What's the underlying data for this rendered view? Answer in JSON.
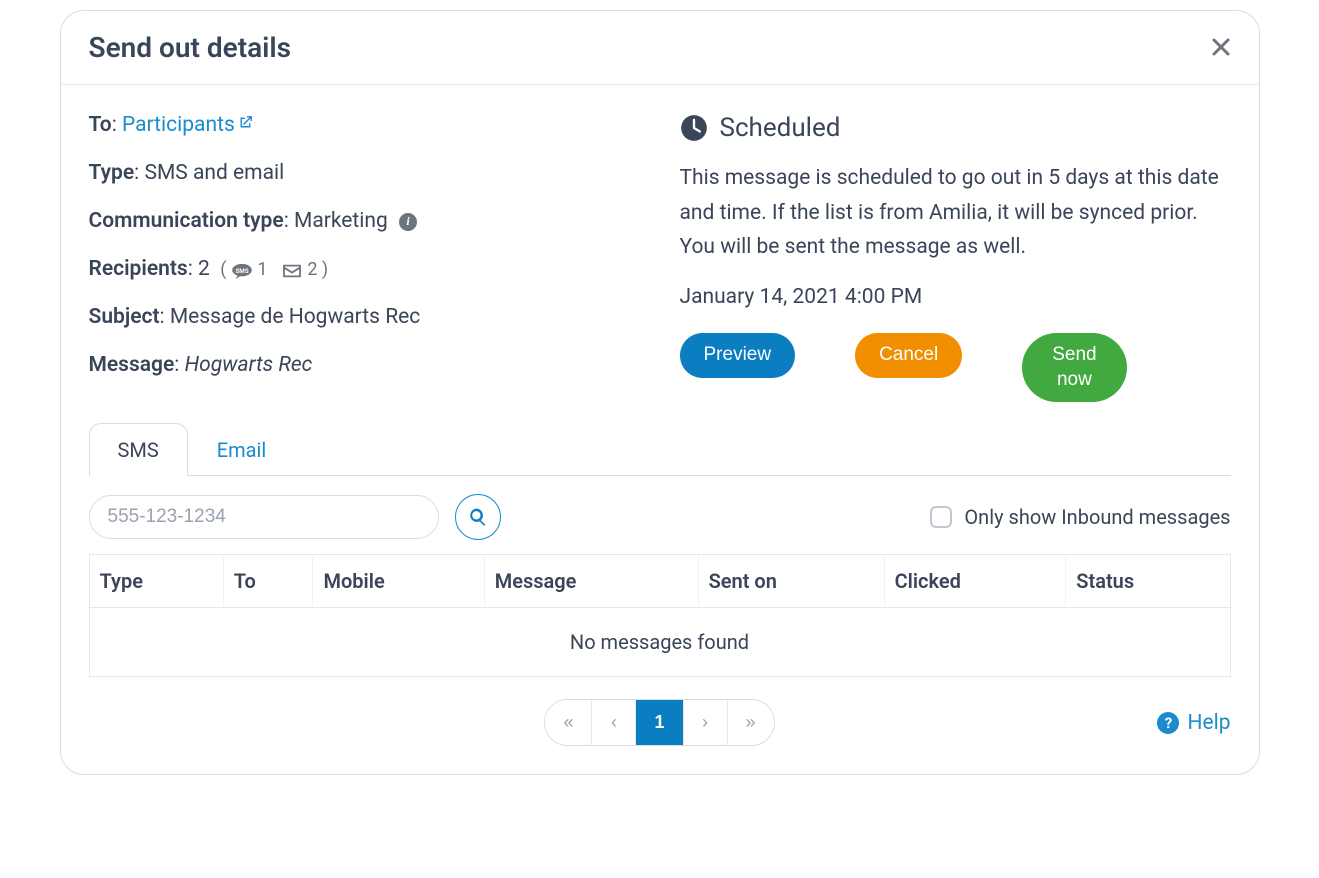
{
  "header": {
    "title": "Send out details"
  },
  "details": {
    "to_label": "To",
    "to_link": "Participants",
    "type_label": "Type",
    "type_value": "SMS and email",
    "comm_type_label": "Communication type",
    "comm_type_value": "Marketing",
    "recipients_label": "Recipients",
    "recipients_count": "2",
    "recipients_sms": "1",
    "recipients_email": "2",
    "subject_label": "Subject",
    "subject_value": "Message de Hogwarts Rec",
    "message_label": "Message",
    "message_value": "Hogwarts Rec"
  },
  "scheduled": {
    "heading": "Scheduled",
    "description": "This message is scheduled to go out in 5 days at this date and time. If the list is from Amilia, it will be synced prior. You will be sent the message as well.",
    "datetime": "January 14, 2021 4:00 PM"
  },
  "buttons": {
    "preview": "Preview",
    "cancel": "Cancel",
    "send_now": "Send now"
  },
  "tabs": {
    "sms": "SMS",
    "email": "Email"
  },
  "filter": {
    "search_placeholder": "555-123-1234",
    "inbound_label": "Only show Inbound messages"
  },
  "table": {
    "headers": [
      "Type",
      "To",
      "Mobile",
      "Message",
      "Sent on",
      "Clicked",
      "Status"
    ],
    "empty": "No messages found"
  },
  "pagination": {
    "current": "1"
  },
  "help": {
    "label": "Help"
  }
}
